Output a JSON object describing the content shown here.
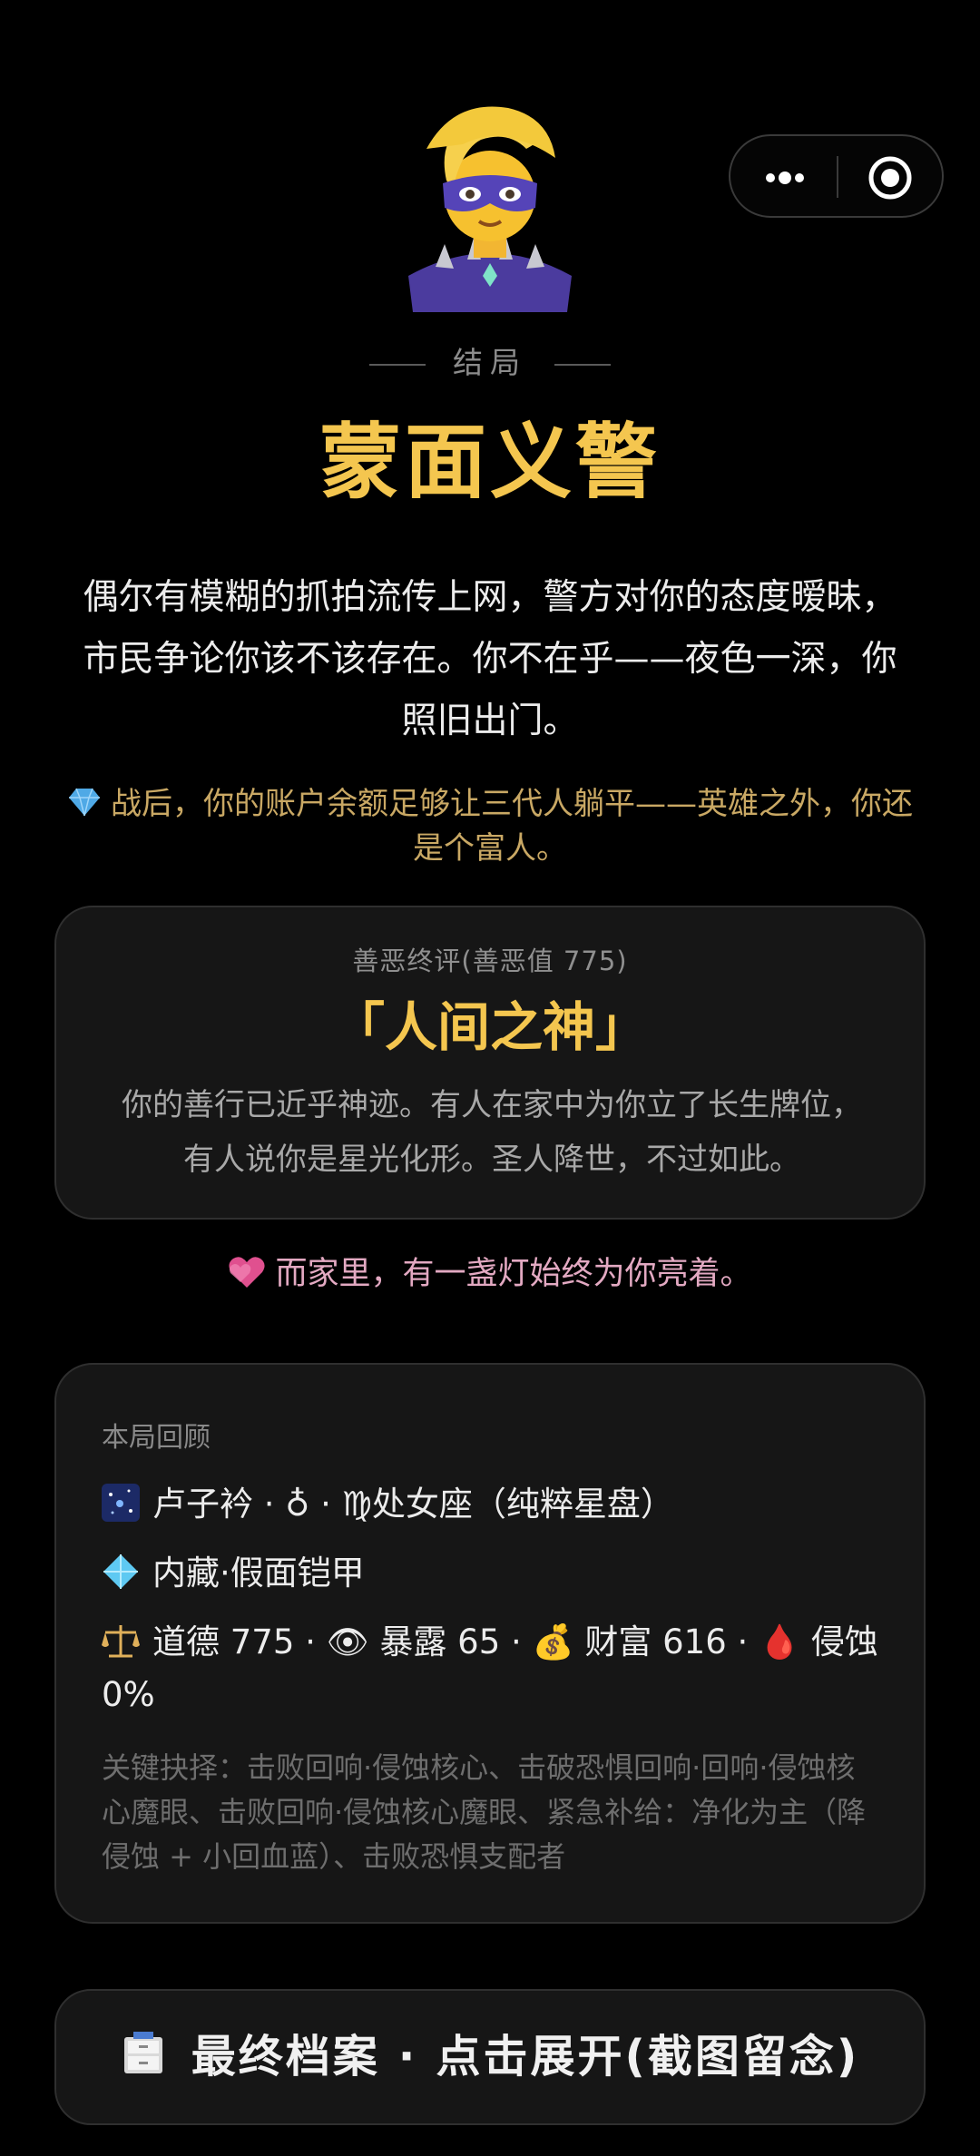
{
  "ending": {
    "label": "结局",
    "title": "蒙面义警",
    "story": "偶尔有模糊的抓拍流传上网，警方对你的态度暧昧，市民争论你该不该存在。你不在乎——夜色一深，你照旧出门。",
    "wealth_note": "战后，你的账户余额足够让三代人躺平——英雄之外，你还是个富人。"
  },
  "verdict": {
    "heading": "善恶终评(善恶值 775)",
    "title": "「人间之神」",
    "text": "你的善行已近乎神迹。有人在家中为你立了长生牌位，有人说你是星光化形。圣人降世，不过如此。"
  },
  "family_note": "而家里，有一盏灯始终为你亮着。",
  "recap": {
    "heading": "本局回顾",
    "line1": "卢子衿 · ♁ · ♍处女座（纯粹星盘）",
    "line2": "内藏·假面铠甲",
    "line3": "道德 775 · 👁 暴露 65 · 💰 财富 616 · 🩸 侵蚀 0%",
    "keys": "关键抉择：击败回响·侵蚀核心、击破恐惧回响·回响·侵蚀核心魔眼、击败回响·侵蚀核心魔眼、紧急补给：净化为主（降侵蚀 + 小回血蓝）、击败恐惧支配者"
  },
  "archive_button": "最终档案 · 点击展开(截图留念)",
  "colors": {
    "gold": "#f4c64f",
    "background": "#000000",
    "card": "#161616"
  },
  "icons": [
    "more-icon",
    "target-icon",
    "gem-icon",
    "heart-icon",
    "galaxy-icon",
    "crystal-icon",
    "scale-icon",
    "eye-icon",
    "moneybag-icon",
    "blood-icon",
    "cabinet-icon"
  ]
}
